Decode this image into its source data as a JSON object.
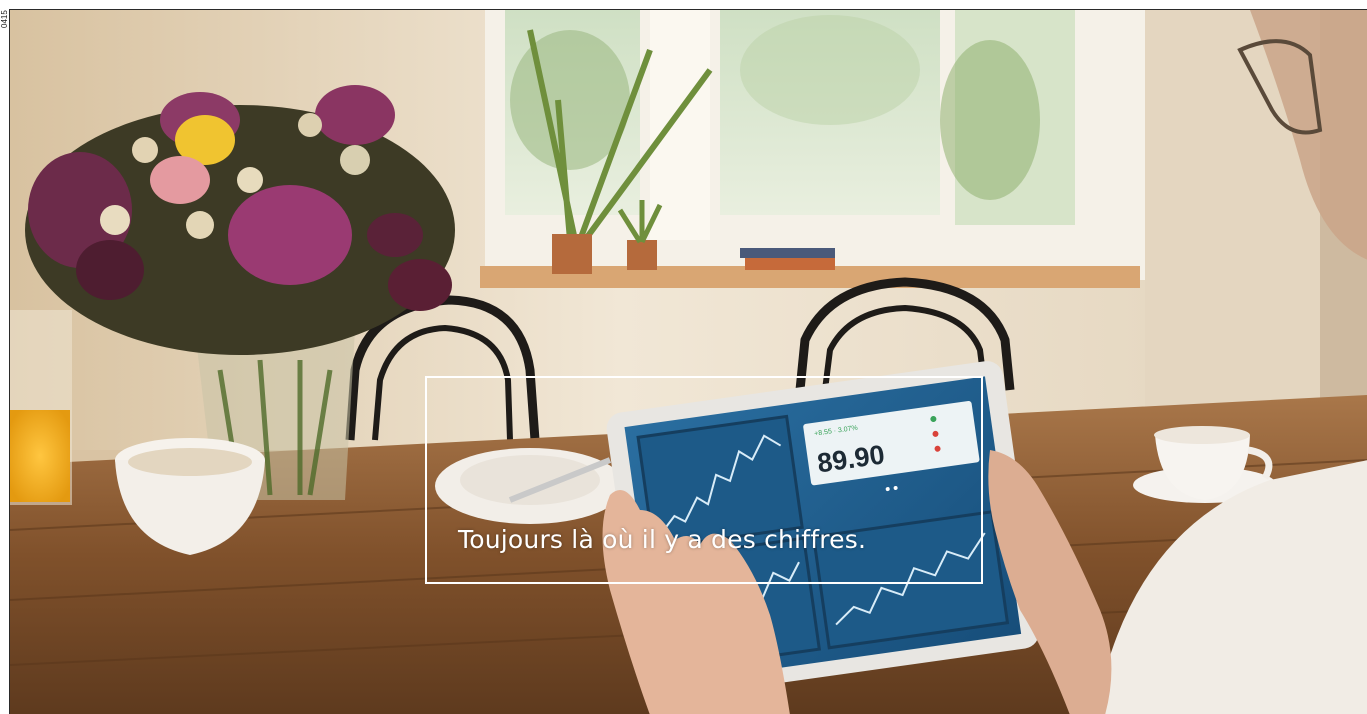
{
  "image_code": "0415",
  "caption": "Toujours là où il y a des chiffres.",
  "tablet": {
    "price": "89.90"
  },
  "colors": {
    "wall": "#e8dcc6",
    "table": "#8a5a32",
    "screen": "#1f5f8f",
    "caption_frame": "#ffffff"
  }
}
